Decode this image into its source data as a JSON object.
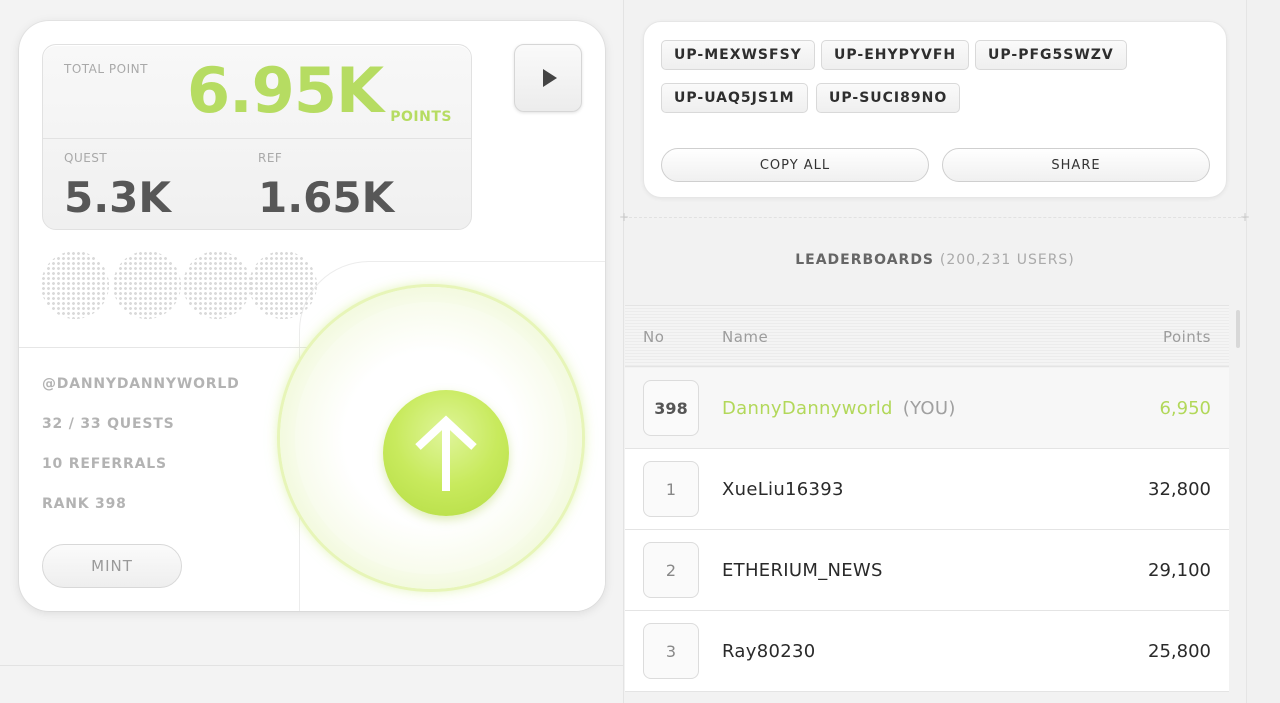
{
  "stats": {
    "total_label": "TOTAL POINT",
    "total_value": "6.95K",
    "total_unit": "POINTS",
    "quest_label": "QUEST",
    "quest_value": "5.3K",
    "ref_label": "REF",
    "ref_value": "1.65K"
  },
  "profile": {
    "username": "@DANNYDANNYWORLD",
    "quests": "32 / 33 QUESTS",
    "referrals": "10 REFERRALS",
    "rank": "RANK 398",
    "mint_label": "MINT"
  },
  "codes": {
    "items": [
      "UP-MEXWSFSY",
      "UP-EHYPYVFH",
      "UP-PFG5SWZV",
      "UP-UAQ5JS1M",
      "UP-SUCI89NO"
    ],
    "copy_all_label": "COPY ALL",
    "share_label": "SHARE"
  },
  "leaderboard": {
    "title": "LEADERBOARDS",
    "users_count": "(200,231 USERS)",
    "columns": {
      "no": "No",
      "name": "Name",
      "points": "Points"
    },
    "self_row": {
      "rank": "398",
      "name": "DannyDannyworld",
      "tag": "(YOU)",
      "points": "6,950"
    },
    "rows": [
      {
        "rank": "1",
        "name": "XueLiu16393",
        "points": "32,800"
      },
      {
        "rank": "2",
        "name": "ETHERIUM_NEWS",
        "points": "29,100"
      },
      {
        "rank": "3",
        "name": "Ray80230",
        "points": "25,800"
      }
    ]
  },
  "colors": {
    "accent": "#b6dc62",
    "text": "#2a2a2a",
    "muted": "#a9a9a9"
  },
  "icons": {
    "play": "play-icon",
    "arrow": "arrow-up-icon"
  }
}
